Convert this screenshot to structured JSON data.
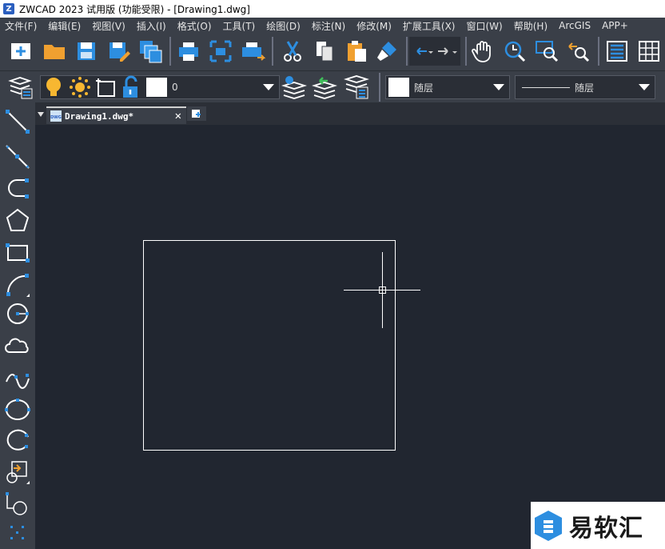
{
  "window": {
    "title": "ZWCAD 2023 试用版 (功能受限) - [Drawing1.dwg]"
  },
  "menu": [
    "文件(F)",
    "编辑(E)",
    "视图(V)",
    "插入(I)",
    "格式(O)",
    "工具(T)",
    "绘图(D)",
    "标注(N)",
    "修改(M)",
    "扩展工具(X)",
    "窗口(W)",
    "帮助(H)",
    "ArcGIS",
    "APP+"
  ],
  "layer": {
    "name": "0"
  },
  "properties": {
    "color": "随层",
    "linetype": "随层"
  },
  "tab": {
    "label": "Drawing1.dwg*",
    "badge": "DWG",
    "close": "✕"
  },
  "watermark": {
    "text": "易软汇"
  },
  "colors": {
    "accent": "#2d8ee0",
    "ui_bg": "#3a3f48",
    "canvas_bg": "#212630"
  }
}
